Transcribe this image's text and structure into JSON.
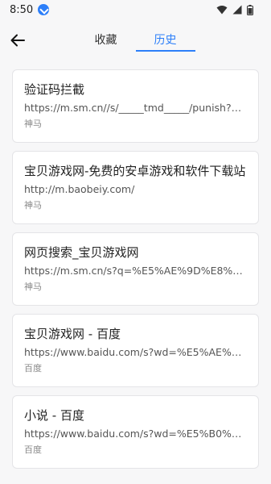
{
  "status_bar": {
    "time": "8:50",
    "icons": [
      "download-icon",
      "wifi-icon",
      "signal-icon",
      "battery-icon"
    ]
  },
  "header": {
    "back_icon": "arrow-left-icon",
    "tabs": [
      {
        "label": "收藏",
        "active": false
      },
      {
        "label": "历史",
        "active": true
      }
    ]
  },
  "accent_color": "#2d7ff9",
  "history": [
    {
      "title": "验证码拦截",
      "url": "https://m.sm.cn//s/_____tmd_____/punish?x5...",
      "source": "神马"
    },
    {
      "title": "宝贝游戏网-免费的安卓游戏和软件下载站",
      "url": "http://m.baobeiy.com/",
      "source": "神马"
    },
    {
      "title": "网页搜索_宝贝游戏网",
      "url": "https://m.sm.cn/s?q=%E5%AE%9D%E8%B4%...",
      "source": "神马"
    },
    {
      "title": "宝贝游戏网 - 百度",
      "url": "https://www.baidu.com/s?wd=%E5%AE%9D%...",
      "source": "百度"
    },
    {
      "title": "小说 - 百度",
      "url": "https://www.baidu.com/s?wd=%E5%B0%8F%...",
      "source": "百度"
    }
  ]
}
